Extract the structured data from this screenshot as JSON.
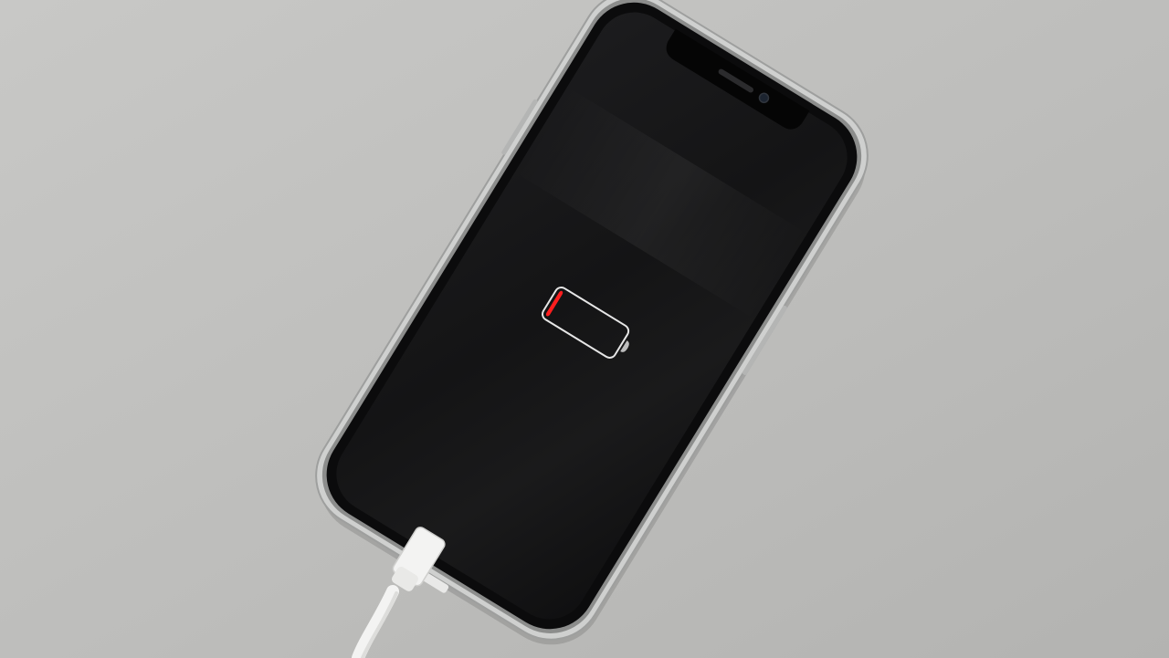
{
  "scene": {
    "background_color": "#bcbcba",
    "background_highlight": "#cdcdcb",
    "phone": {
      "frame_color": "#cfd0cf",
      "bezel_color": "#0b0b0c",
      "screen_color": "#141415",
      "speaker_icon": "speaker-grille-icon",
      "camera_icon": "front-camera-icon"
    },
    "battery": {
      "icon": "low-battery-icon",
      "level_percent": 5,
      "outline_color": "#e6e6e6",
      "fill_color": "#ff1e1e"
    },
    "cable": {
      "icon": "lightning-cable-icon",
      "color": "#f3f3f2",
      "shade_color": "#d7d7d5"
    }
  }
}
